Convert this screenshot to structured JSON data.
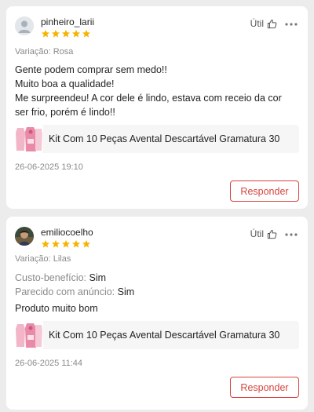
{
  "colors": {
    "star": "#f5b400",
    "accent": "#d7443e",
    "muted": "#8a8a8a",
    "background": "#ececec",
    "card": "#ffffff"
  },
  "reviews": [
    {
      "username": "pinheiro_larii",
      "rating": 5,
      "helpful_label": "Útil",
      "variation": "Variação: Rosa",
      "text_lines": [
        "Gente podem comprar sem medo!!",
        "Muito boa a qualidade!",
        "Me surpreendeu! A cor dele é lindo, estava com receio da cor",
        "ser frio, porém é lindo!!"
      ],
      "product_title": "Kit Com 10 Peças Avental Descartável Gramatura 30",
      "date": "26-06-2025 19:10",
      "reply_label": "Responder"
    },
    {
      "username": "emiliocoelho",
      "rating": 5,
      "helpful_label": "Útil",
      "variation": "Variação: Lilas",
      "attributes": [
        {
          "key": "Custo-benefício:",
          "value": "Sim"
        },
        {
          "key": "Parecido com anúncio:",
          "value": "Sim"
        }
      ],
      "text": "Produto muito bom",
      "product_title": "Kit Com 10 Peças Avental Descartável Gramatura 30",
      "date": "26-06-2025 11:44",
      "reply_label": "Responder"
    }
  ]
}
